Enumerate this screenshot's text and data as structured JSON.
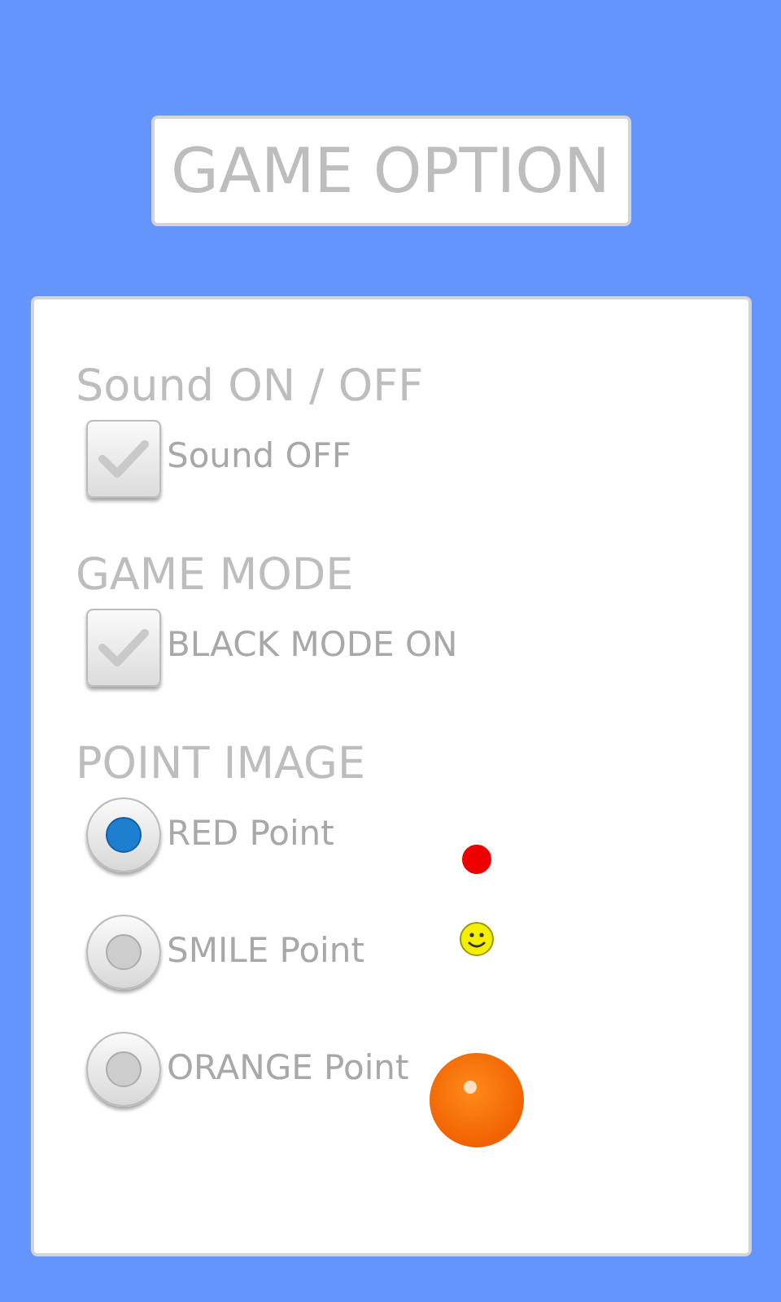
{
  "title": "GAME OPTION",
  "sections": [
    {
      "heading": "Sound ON / OFF",
      "kind": "checkbox",
      "options": [
        {
          "label": "Sound OFF",
          "checked": true
        }
      ]
    },
    {
      "heading": "GAME MODE",
      "kind": "checkbox",
      "options": [
        {
          "label": "BLACK MODE ON",
          "checked": true
        }
      ]
    },
    {
      "heading": "POINT IMAGE",
      "kind": "radio",
      "options": [
        {
          "label": "RED Point",
          "selected": true,
          "kind": "dot"
        },
        {
          "label": "SMILE Point",
          "selected": false,
          "kind": "smiley"
        },
        {
          "label": "ORANGE Point",
          "selected": false,
          "kind": "ball"
        }
      ]
    }
  ]
}
